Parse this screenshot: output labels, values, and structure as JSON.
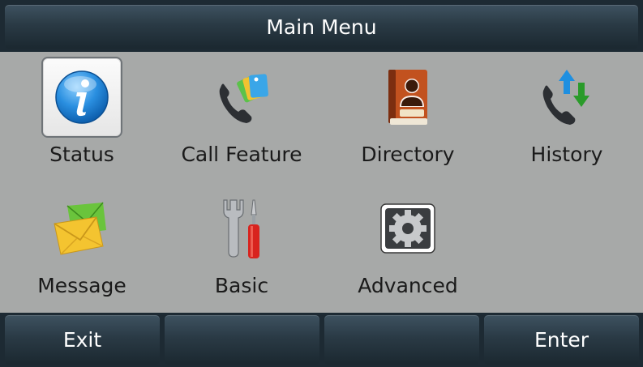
{
  "title": "Main Menu",
  "menu": {
    "items": [
      {
        "label": "Status",
        "icon": "info-icon",
        "selected": true
      },
      {
        "label": "Call Feature",
        "icon": "call-feature-icon"
      },
      {
        "label": "Directory",
        "icon": "directory-icon"
      },
      {
        "label": "History",
        "icon": "history-icon"
      },
      {
        "label": "Message",
        "icon": "message-icon"
      },
      {
        "label": "Basic",
        "icon": "basic-tools-icon"
      },
      {
        "label": "Advanced",
        "icon": "advanced-gear-icon"
      }
    ]
  },
  "softkeys": [
    "Exit",
    "",
    "",
    "Enter"
  ],
  "colors": {
    "background": "#a7a9a8",
    "bar": "#2a3a45",
    "selection": "#f3f3f3"
  }
}
